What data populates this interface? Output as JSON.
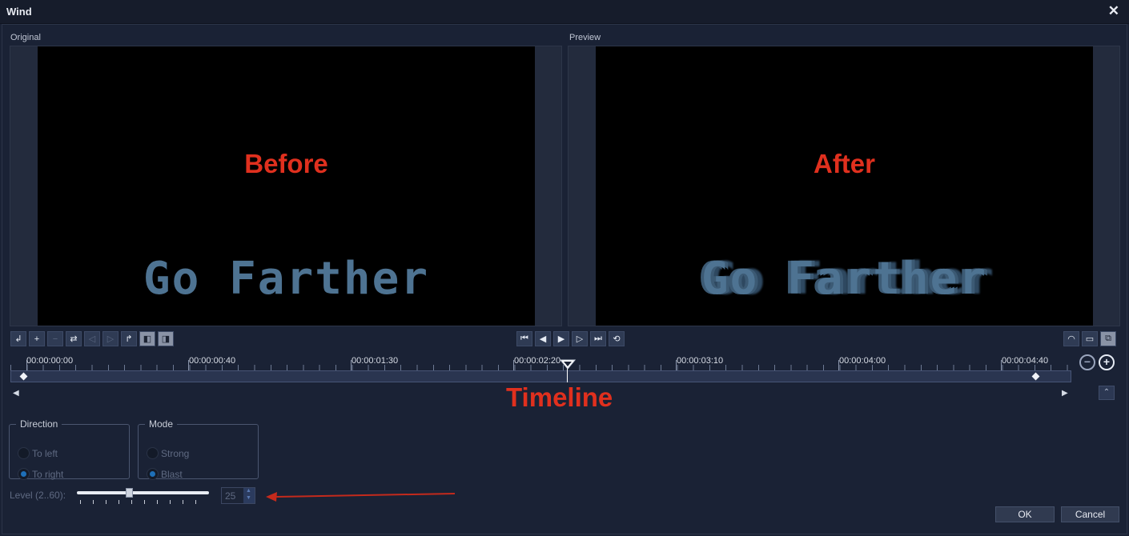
{
  "window": {
    "title": "Wind",
    "close_glyph": "✕"
  },
  "panes": {
    "original": {
      "label": "Original",
      "overlay_text": "Before",
      "video_text": "Go Farther"
    },
    "preview": {
      "label": "Preview",
      "overlay_text": "After",
      "video_text": "Go Farther"
    }
  },
  "toolbar_left": [
    "add-keyframe-icon",
    "plus-icon",
    "minus-icon",
    "reverse-icon",
    "prev-keyframe-icon",
    "next-keyframe-icon",
    "redo-icon",
    "copy-attribute-icon",
    "paste-attribute-icon"
  ],
  "transport": [
    "go-to-start-icon",
    "step-back-icon",
    "play-icon",
    "step-forward-icon",
    "go-to-end-icon",
    "repeat-icon"
  ],
  "toolbar_right": [
    "speed-icon",
    "monitor-icon",
    "preview-window-icon"
  ],
  "timeline": {
    "ticks": [
      "00:00:00:00",
      "00:00:00:40",
      "00:00:01:30",
      "00:00:02:20",
      "00:00:03:10",
      "00:00:04:00",
      "00:00:04:40"
    ],
    "label": "Timeline",
    "zoom_out_glyph": "−",
    "zoom_in_glyph": "+",
    "left_arrow": "◀",
    "right_arrow": "▶",
    "collapse_glyph": "⌃"
  },
  "direction": {
    "legend": "Direction",
    "options": [
      {
        "label": "To left",
        "selected": false
      },
      {
        "label": "To right",
        "selected": true
      }
    ]
  },
  "mode": {
    "legend": "Mode",
    "options": [
      {
        "label": "Strong",
        "selected": false
      },
      {
        "label": "Blast",
        "selected": true
      }
    ]
  },
  "level": {
    "label": "Level (2..60):",
    "value": "25",
    "range_min": 2,
    "range_max": 60
  },
  "buttons": {
    "ok": "OK",
    "cancel": "Cancel"
  },
  "colors": {
    "annotation": "#e0301e",
    "background": "#1a2235",
    "accent": "#1e6fb8"
  }
}
